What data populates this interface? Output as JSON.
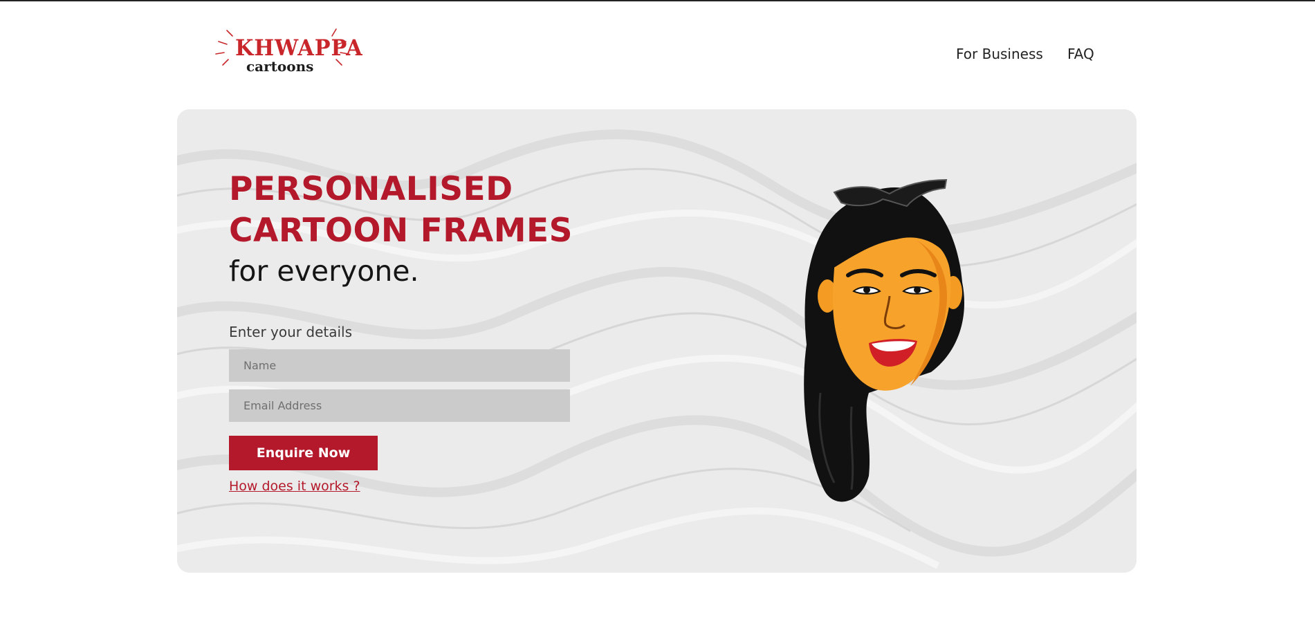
{
  "brand": {
    "logo_title": "KHWAPPA",
    "logo_subtitle": "cartoons",
    "accent_color": "#b3192a"
  },
  "nav": {
    "items": [
      {
        "label": "For Business"
      },
      {
        "label": "FAQ"
      }
    ]
  },
  "hero": {
    "headline_line1": "PERSONALISED",
    "headline_line2": "CARTOON FRAMES",
    "subline": "for everyone.",
    "form": {
      "label": "Enter your details",
      "name_placeholder": "Name",
      "name_value": "",
      "email_placeholder": "Email Address",
      "email_value": "",
      "submit_label": "Enquire Now"
    },
    "help_link": "How does it works ?",
    "illustration": "cartoon-portrait-woman-with-sunglasses"
  }
}
